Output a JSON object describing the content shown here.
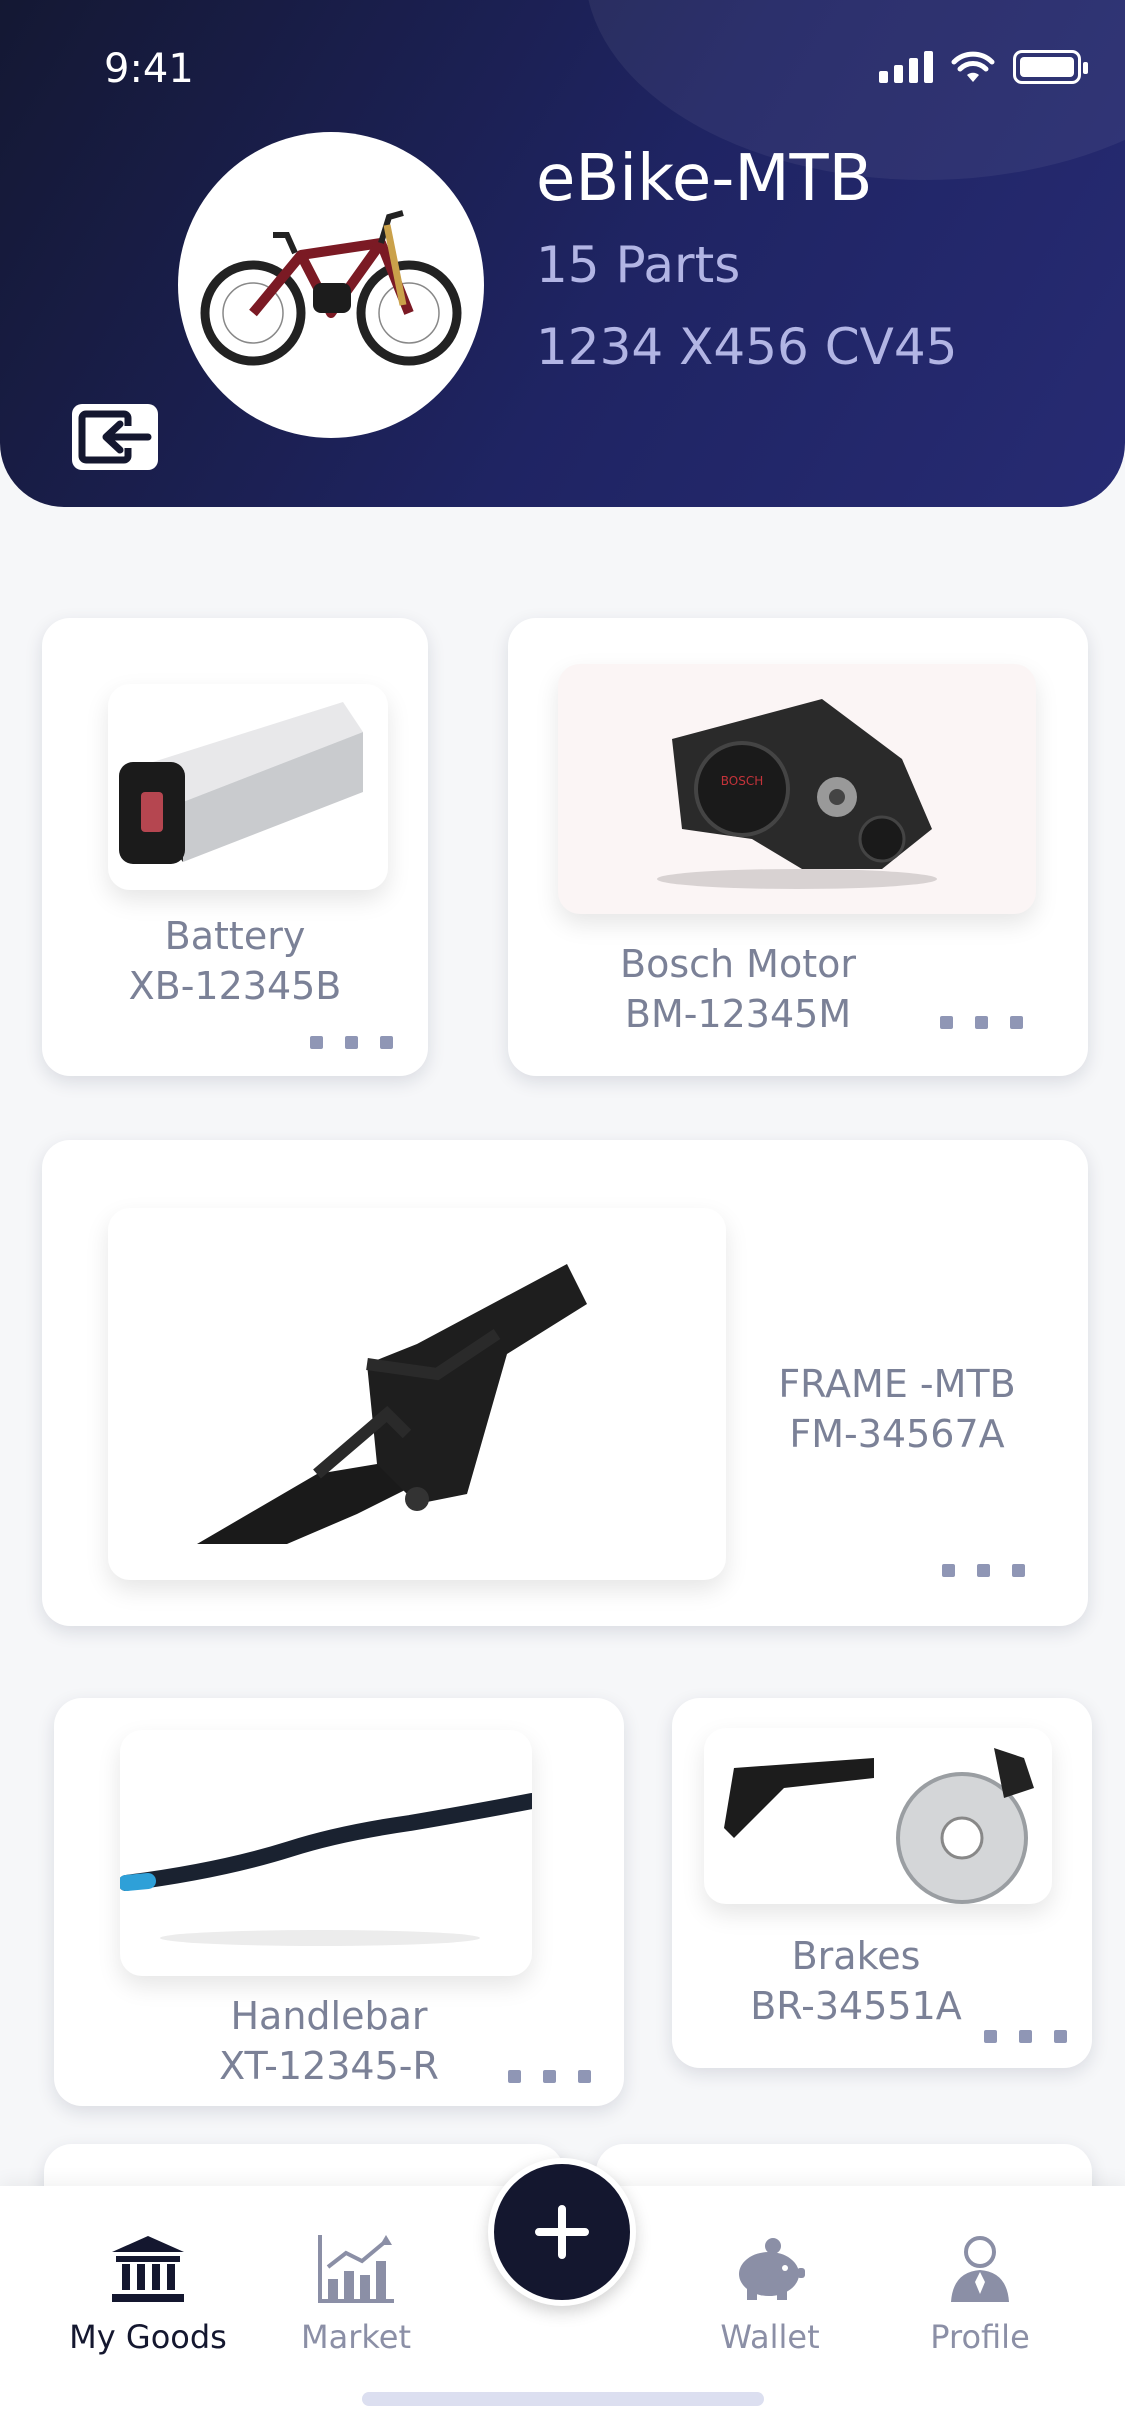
{
  "status_bar": {
    "time": "9:41"
  },
  "header": {
    "title": "eBike-MTB",
    "parts": "15 Parts",
    "code": "1234 X456 CV45"
  },
  "parts": [
    {
      "name": "Battery",
      "code": "XB-12345B"
    },
    {
      "name": "Bosch Motor",
      "code": "BM-12345M"
    },
    {
      "name": "FRAME -MTB",
      "code": "FM-34567A"
    },
    {
      "name": "Handlebar",
      "code": "XT-12345-R"
    },
    {
      "name": "Brakes",
      "code": "BR-34551A"
    }
  ],
  "tabs": [
    {
      "label": "My Goods",
      "icon": "bank-icon"
    },
    {
      "label": "Market",
      "icon": "chart-icon"
    },
    {
      "label": "Wallet",
      "icon": "piggy-bank-icon"
    },
    {
      "label": "Profile",
      "icon": "person-icon"
    }
  ],
  "colors": {
    "header_dark": "#141833",
    "header_accent": "#272b73",
    "fab": "#14172f",
    "muted_text": "#7b8197"
  }
}
